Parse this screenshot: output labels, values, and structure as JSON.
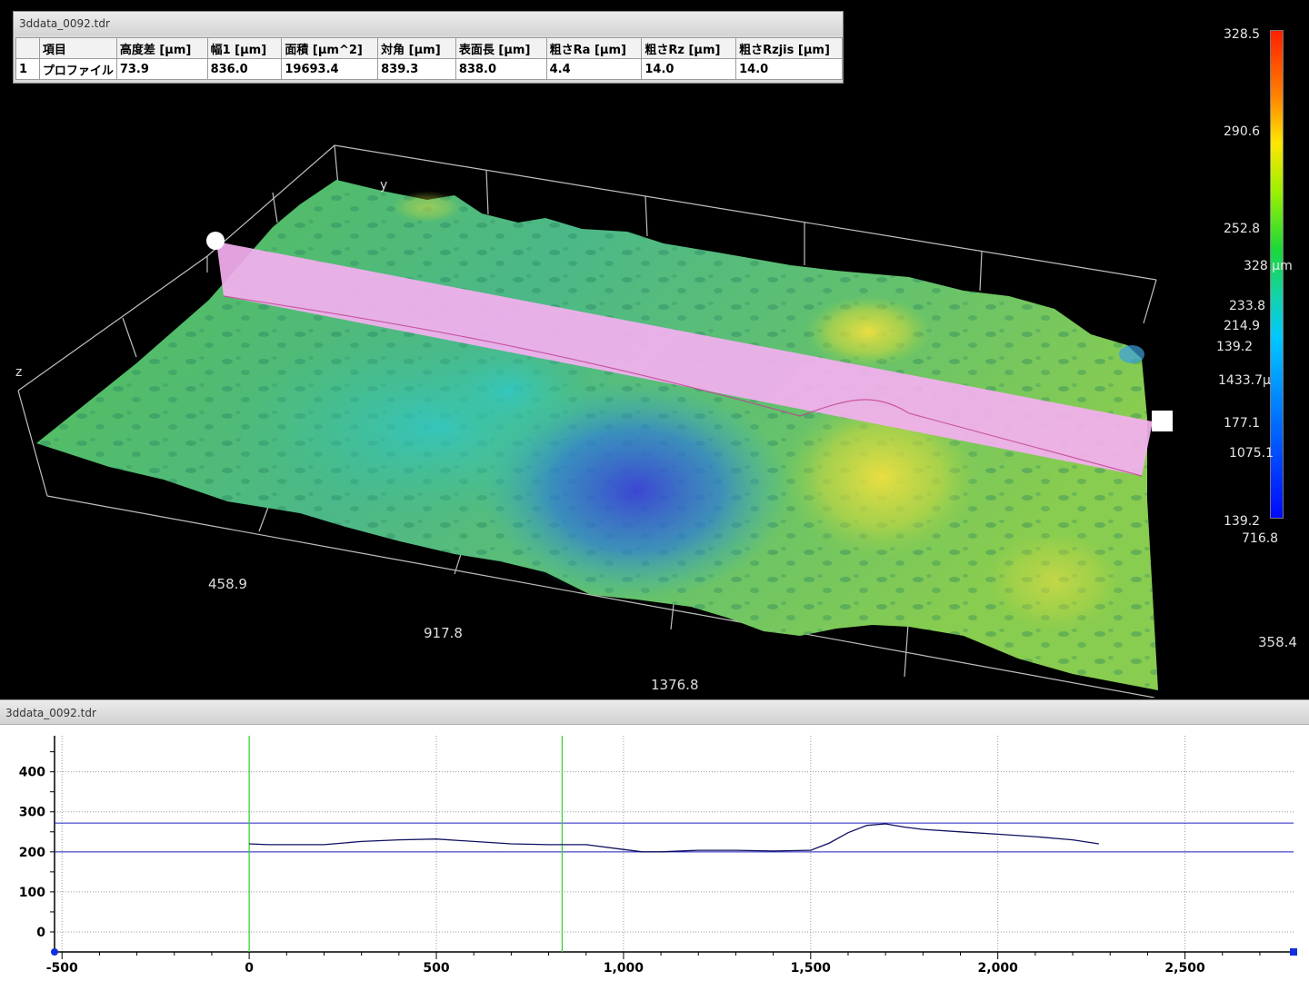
{
  "window": {
    "title": "3ddata_0092.tdr"
  },
  "results_table": {
    "headers": [
      "",
      "項目",
      "高度差 [μm]",
      "幅1 [μm]",
      "面積 [μm^2]",
      "対角 [μm]",
      "表面長 [μm]",
      "粗さRa [μm]",
      "粗さRz [μm]",
      "粗さRzjis [μm]"
    ],
    "rows": [
      [
        "1",
        "プロファイル",
        "73.9",
        "836.0",
        "19693.4",
        "839.3",
        "838.0",
        "4.4",
        "14.0",
        "14.0"
      ]
    ]
  },
  "view3d": {
    "axis_labels": {
      "y": "y",
      "z": "z"
    },
    "x_ticks": [
      "458.9",
      "917.8",
      "1376.8"
    ],
    "right_edge_value": "358.4"
  },
  "colorbar": {
    "labels": [
      "328.5",
      "290.6",
      "252.8",
      "328 μm",
      "233.8",
      "214.9",
      "139.2",
      "1433.7μ",
      "177.1",
      "1075.1",
      "139.2",
      "716.8"
    ],
    "colors": [
      "#ff1f00",
      "#ffe600",
      "#19d83a",
      "#00c8ff",
      "#0008ff"
    ]
  },
  "profile": {
    "title": "3ddata_0092.tdr",
    "y_ticks": [
      "400",
      "300",
      "200",
      "100",
      "0"
    ],
    "x_ticks": [
      "-500",
      "0",
      "500",
      "1,000",
      "1,500",
      "2,000",
      "2,500"
    ],
    "chart_data": {
      "type": "line",
      "xlim": [
        -520,
        2790
      ],
      "ylim": [
        -50,
        490
      ],
      "series": [
        {
          "x": [
            0,
            50,
            100,
            200,
            300,
            400,
            500,
            600,
            700,
            800,
            900,
            1000,
            1050,
            1100,
            1200,
            1300,
            1400,
            1500,
            1550,
            1600,
            1650,
            1700,
            1750,
            1800,
            1900,
            2000,
            2100,
            2200,
            2270
          ],
          "y": [
            220,
            218,
            218,
            218,
            226,
            230,
            232,
            226,
            220,
            218,
            218,
            206,
            200,
            200,
            204,
            204,
            202,
            204,
            222,
            248,
            266,
            270,
            262,
            256,
            250,
            244,
            238,
            230,
            220
          ]
        }
      ],
      "hlines": [
        272,
        200
      ],
      "vlines": [
        0,
        836
      ]
    }
  }
}
